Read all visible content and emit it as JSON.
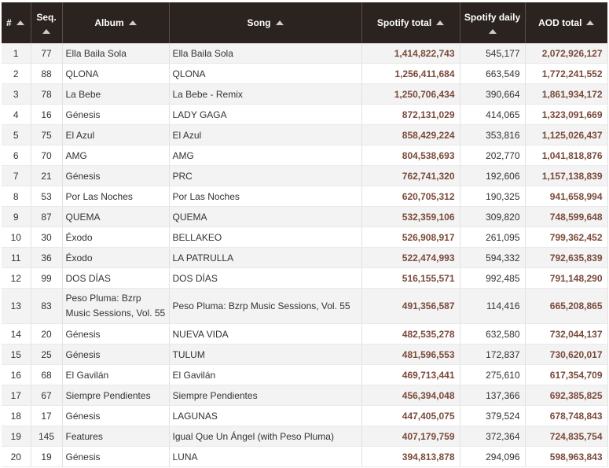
{
  "table": {
    "headers": {
      "num": "#",
      "seq": "Seq.",
      "album": "Album",
      "song": "Song",
      "spotify_total": "Spotify total",
      "spotify_daily": "Spotify daily",
      "aod_total": "AOD total"
    },
    "rows": [
      {
        "num": "1",
        "seq": "77",
        "album": "Ella Baila Sola",
        "song": "Ella Baila Sola",
        "spotify_total": "1,414,822,743",
        "spotify_daily": "545,177",
        "aod_total": "2,072,926,127"
      },
      {
        "num": "2",
        "seq": "88",
        "album": "QLONA",
        "song": "QLONA",
        "spotify_total": "1,256,411,684",
        "spotify_daily": "663,549",
        "aod_total": "1,772,241,552"
      },
      {
        "num": "3",
        "seq": "78",
        "album": "La Bebe",
        "song": "La Bebe - Remix",
        "spotify_total": "1,250,706,434",
        "spotify_daily": "390,664",
        "aod_total": "1,861,934,172"
      },
      {
        "num": "4",
        "seq": "16",
        "album": "Génesis",
        "song": "LADY GAGA",
        "spotify_total": "872,131,029",
        "spotify_daily": "414,065",
        "aod_total": "1,323,091,669"
      },
      {
        "num": "5",
        "seq": "75",
        "album": "El Azul",
        "song": "El Azul",
        "spotify_total": "858,429,224",
        "spotify_daily": "353,816",
        "aod_total": "1,125,026,437"
      },
      {
        "num": "6",
        "seq": "70",
        "album": "AMG",
        "song": "AMG",
        "spotify_total": "804,538,693",
        "spotify_daily": "202,770",
        "aod_total": "1,041,818,876"
      },
      {
        "num": "7",
        "seq": "21",
        "album": "Génesis",
        "song": "PRC",
        "spotify_total": "762,741,320",
        "spotify_daily": "192,606",
        "aod_total": "1,157,138,839"
      },
      {
        "num": "8",
        "seq": "53",
        "album": "Por Las Noches",
        "song": "Por Las Noches",
        "spotify_total": "620,705,312",
        "spotify_daily": "190,325",
        "aod_total": "941,658,994"
      },
      {
        "num": "9",
        "seq": "87",
        "album": "QUEMA",
        "song": "QUEMA",
        "spotify_total": "532,359,106",
        "spotify_daily": "309,820",
        "aod_total": "748,599,648"
      },
      {
        "num": "10",
        "seq": "30",
        "album": "Éxodo",
        "song": "BELLAKEO",
        "spotify_total": "526,908,917",
        "spotify_daily": "261,095",
        "aod_total": "799,362,452"
      },
      {
        "num": "11",
        "seq": "36",
        "album": "Éxodo",
        "song": "LA PATRULLA",
        "spotify_total": "522,474,993",
        "spotify_daily": "594,332",
        "aod_total": "792,635,839"
      },
      {
        "num": "12",
        "seq": "99",
        "album": "DOS DÍAS",
        "song": "DOS DÍAS",
        "spotify_total": "516,155,571",
        "spotify_daily": "992,485",
        "aod_total": "791,148,290"
      },
      {
        "num": "13",
        "seq": "83",
        "album": "Peso Pluma: Bzrp Music Sessions, Vol. 55",
        "song": "Peso Pluma: Bzrp Music Sessions, Vol. 55",
        "spotify_total": "491,356,587",
        "spotify_daily": "114,416",
        "aod_total": "665,208,865"
      },
      {
        "num": "14",
        "seq": "20",
        "album": "Génesis",
        "song": "NUEVA VIDA",
        "spotify_total": "482,535,278",
        "spotify_daily": "632,580",
        "aod_total": "732,044,137"
      },
      {
        "num": "15",
        "seq": "25",
        "album": "Génesis",
        "song": "TULUM",
        "spotify_total": "481,596,553",
        "spotify_daily": "172,837",
        "aod_total": "730,620,017"
      },
      {
        "num": "16",
        "seq": "68",
        "album": "El Gavilán",
        "song": "El Gavilán",
        "spotify_total": "469,713,441",
        "spotify_daily": "275,610",
        "aod_total": "617,354,709"
      },
      {
        "num": "17",
        "seq": "67",
        "album": "Siempre Pendientes",
        "song": "Siempre Pendientes",
        "spotify_total": "456,394,048",
        "spotify_daily": "137,366",
        "aod_total": "692,385,825"
      },
      {
        "num": "18",
        "seq": "17",
        "album": "Génesis",
        "song": "LAGUNAS",
        "spotify_total": "447,405,075",
        "spotify_daily": "379,524",
        "aod_total": "678,748,843"
      },
      {
        "num": "19",
        "seq": "145",
        "album": "Features",
        "song": "Igual Que Un Ángel (with Peso Pluma)",
        "spotify_total": "407,179,759",
        "spotify_daily": "372,364",
        "aod_total": "724,835,754"
      },
      {
        "num": "20",
        "seq": "19",
        "album": "Génesis",
        "song": "LUNA",
        "spotify_total": "394,813,878",
        "spotify_daily": "294,096",
        "aod_total": "598,963,843"
      }
    ]
  }
}
